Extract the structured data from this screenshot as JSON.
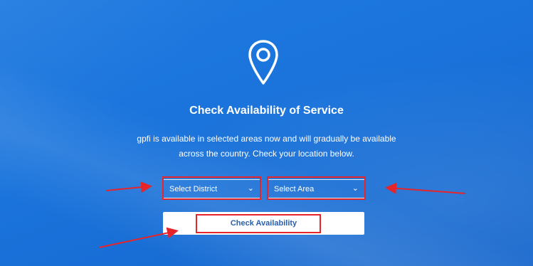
{
  "page": {
    "title": "Check Availability of Service",
    "description": "gpfi is available in selected areas now and will gradually be available across the country. Check your location below."
  },
  "filters": {
    "district": {
      "label": "Select District",
      "icon": "chevron-down-icon"
    },
    "area": {
      "label": "Select Area",
      "icon": "chevron-down-icon"
    }
  },
  "actions": {
    "check_label": "Check Availability"
  },
  "icons": {
    "hero": "location-pin-icon"
  },
  "colors": {
    "background": "#1a74dc",
    "annotation": "#e5252a",
    "button_text": "#2a5fae"
  }
}
